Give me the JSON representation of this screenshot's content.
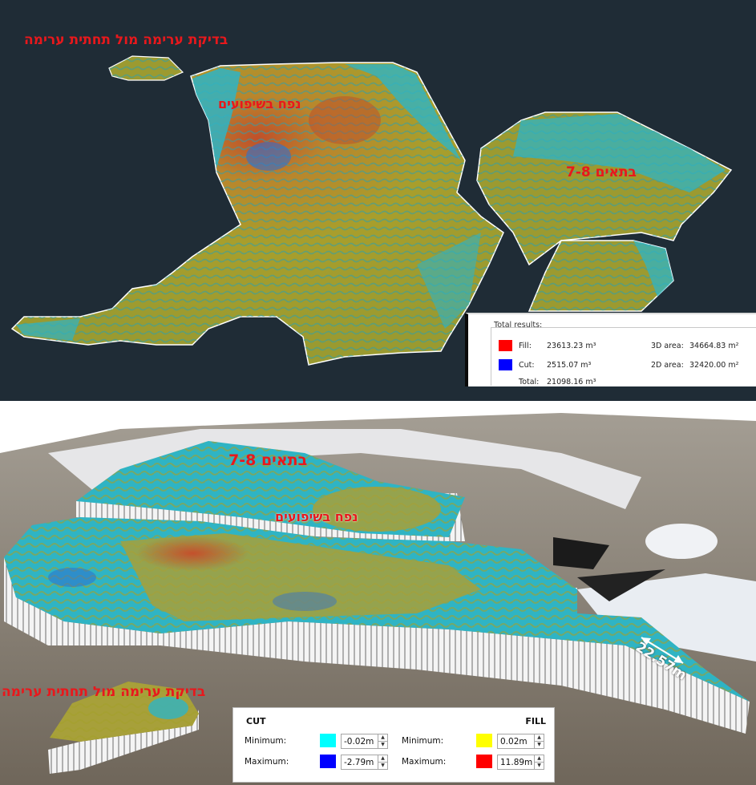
{
  "top_view": {
    "labels": {
      "pile_check": "בדיקת ערימה מול תחתית ערימה",
      "napah": "נפח בשיפועים",
      "cells": "בתאים 7-8"
    }
  },
  "results": {
    "title": "Total results:",
    "fill_label": "Fill:",
    "fill_value": "23613.23 m³",
    "cut_label": "Cut:",
    "cut_value": "2515.07 m³",
    "total_label": "Total:",
    "total_value": "21098.16 m³",
    "area3d_label": "3D area:",
    "area3d_value": "34664.83 m²",
    "area2d_label": "2D area:",
    "area2d_value": "32420.00 m²",
    "colors": {
      "fill": "#ff0000",
      "cut": "#0000ff"
    }
  },
  "bottom_view": {
    "labels": {
      "cells": "בתאים 7-8",
      "napah": "נפח בשיפועים",
      "pile_check": "בדיקת ערימה מול תחתית ערימה"
    },
    "dimension": "22.57m"
  },
  "legend": {
    "cut_title": "CUT",
    "fill_title": "FILL",
    "min_label": "Minimum:",
    "max_label": "Maximum:",
    "cut_min": "-0.02m",
    "cut_max": "-2.79m",
    "fill_min": "0.02m",
    "fill_max": "11.89m",
    "colors": {
      "cut_min": "#00ffff",
      "cut_max": "#0000ff",
      "fill_min": "#ffff00",
      "fill_max": "#ff0000"
    }
  }
}
